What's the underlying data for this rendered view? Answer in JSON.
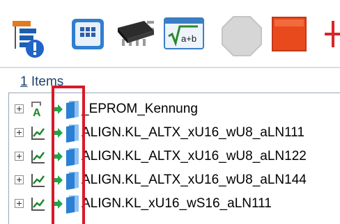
{
  "toolbar": {
    "buttons": [
      {
        "icon": "tree-info-icon"
      },
      {
        "icon": "grid-window-icon"
      },
      {
        "icon": "chip-icon"
      },
      {
        "icon": "formula-icon",
        "text": "a+b"
      },
      {
        "icon": "stop-octagon-icon"
      },
      {
        "icon": "red-square-icon"
      },
      {
        "icon": "plus-icon"
      }
    ]
  },
  "items_count": {
    "number": "1",
    "text": "Items"
  },
  "tree": {
    "rows": [
      {
        "label": "_EPROM_Kennung",
        "type_icon": "text-value-icon",
        "type_letter": "A"
      },
      {
        "label": "ALIGN.KL_ALTX_xU16_wU8_aLN111",
        "type_icon": "curve-icon"
      },
      {
        "label": "ALIGN.KL_ALTX_xU16_wU8_aLN122",
        "type_icon": "curve-icon"
      },
      {
        "label": "ALIGN.KL_ALTX_xU16_wU8_aLN144",
        "type_icon": "curve-icon"
      },
      {
        "label": "ALIGN.KL_xU16_wS16_aLN111",
        "type_icon": "curve-icon"
      }
    ]
  },
  "colors": {
    "highlight": "#d9192b",
    "arrow_green": "#1fa64a",
    "folder_blue": "#2b7fd4",
    "items_text": "#1d3f6e"
  }
}
